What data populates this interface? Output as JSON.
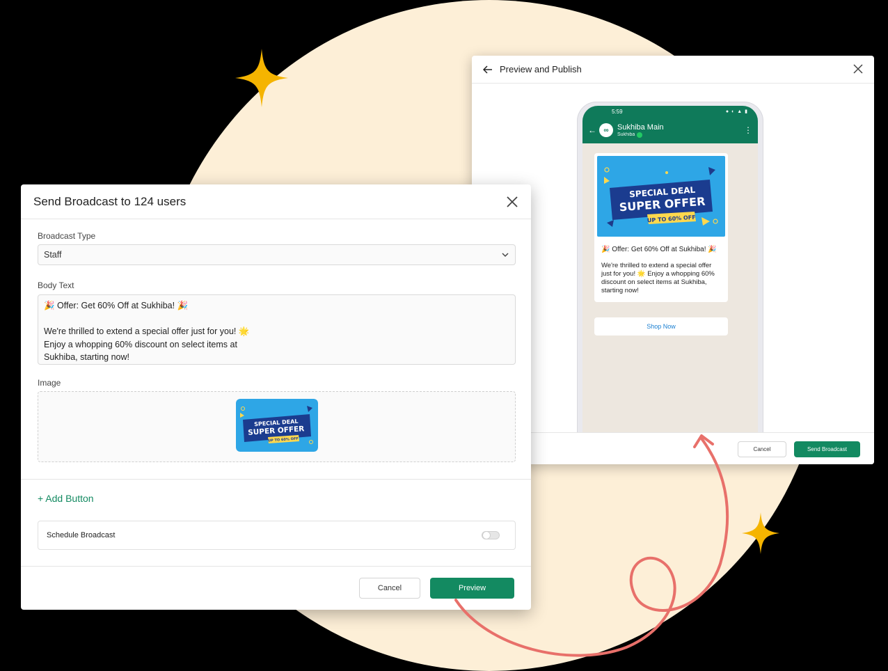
{
  "colors": {
    "background": "#000000",
    "circle": "#fdefd7",
    "brand_green": "#138a61",
    "whatsapp_green": "#0f7a5a",
    "sparkle": "#f5b400",
    "arrow": "#e8706a"
  },
  "broadcast_modal": {
    "title": "Send Broadcast to 124 users",
    "broadcast_type_label": "Broadcast Type",
    "broadcast_type_value": "Staff",
    "body_text_label": "Body Text",
    "body_lines": [
      "🎉 Offer: Get 60% Off at Sukhiba! 🎉",
      "",
      "We're thrilled to extend a special offer just for you! 🌟",
      "Enjoy a whopping 60% discount on select items at",
      "Sukhiba, starting now!"
    ],
    "image_label": "Image",
    "add_button_label": "+ Add Button",
    "schedule_label": "Schedule Broadcast",
    "schedule_enabled": false,
    "cancel_label": "Cancel",
    "preview_label": "Preview"
  },
  "preview_panel": {
    "title": "Preview and Publish",
    "cancel_label": "Cancel",
    "send_label": "Send Broadcast",
    "phone": {
      "time": "5:59",
      "chat_name": "Sukhiba Main",
      "chat_sub": "Sukhiba",
      "message_title": "🎉 Offer: Get 60% Off at Sukhiba! 🎉",
      "message_body": "We're thrilled to extend a special offer just for you! 🌟 Enjoy a whopping 60% discount on select items at Sukhiba, starting now!",
      "button_label": "Shop Now"
    }
  },
  "offer_banner": {
    "line1": "SPECIAL DEAL",
    "line2": "SUPER OFFER",
    "line3": "UP TO 60% OFF"
  }
}
